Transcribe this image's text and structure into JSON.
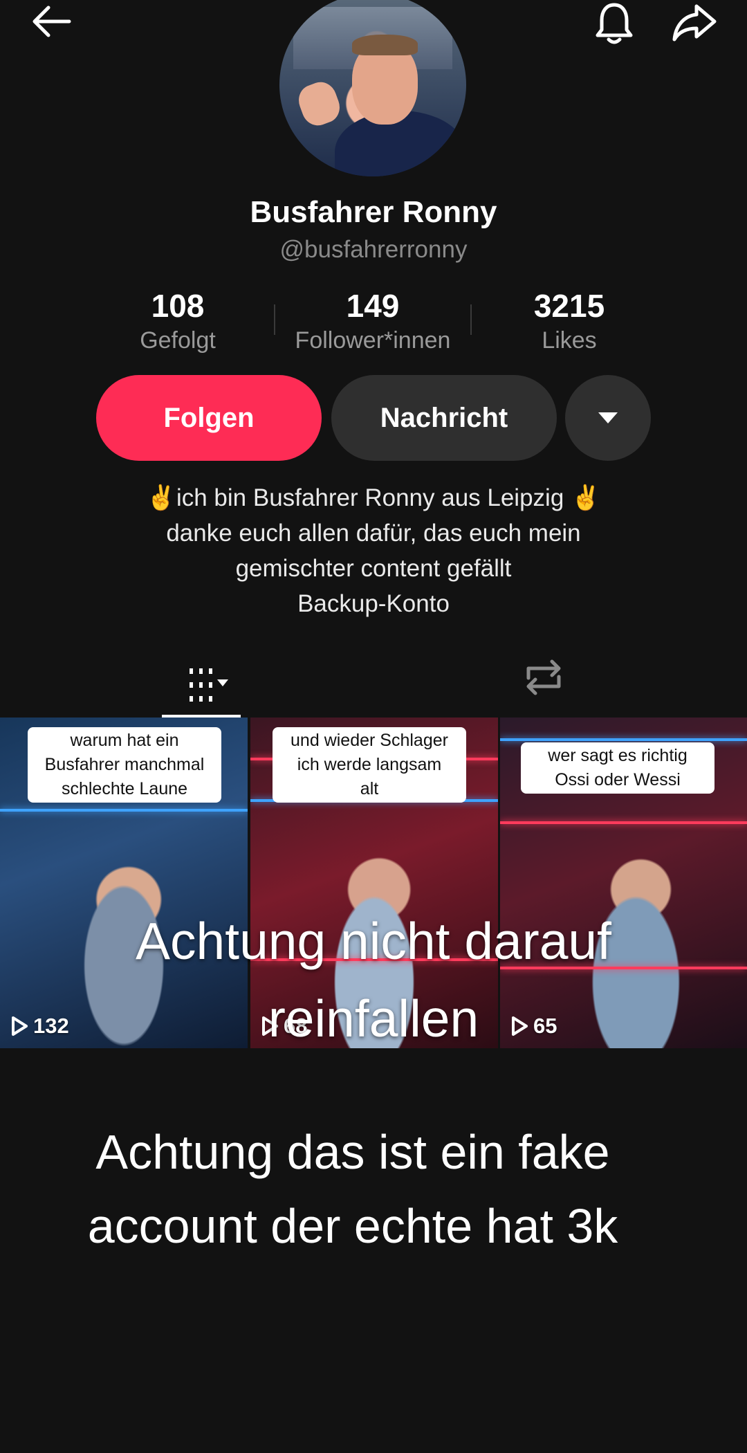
{
  "header": {
    "back_icon": "arrow-left-icon",
    "bell_icon": "bell-icon",
    "share_icon": "share-arrow-icon"
  },
  "profile": {
    "name": "Busfahrer Ronny",
    "handle": "@busfahrerronny",
    "avatar": "profile-photo"
  },
  "stats": {
    "following": {
      "value": "108",
      "label": "Gefolgt"
    },
    "followers": {
      "value": "149",
      "label": "Follower*innen"
    },
    "likes": {
      "value": "3215",
      "label": "Likes"
    }
  },
  "actions": {
    "follow_label": "Folgen",
    "message_label": "Nachricht",
    "more_icon": "caret-down-icon"
  },
  "bio": {
    "line1": "✌️ich bin Busfahrer Ronny aus Leipzig ✌️",
    "line2": "danke euch allen dafür, das euch mein",
    "line3": "gemischter content gefällt",
    "line4": "Backup-Konto"
  },
  "tabs": {
    "videos_icon": "grid-columns-icon",
    "reposts_icon": "repost-icon"
  },
  "videos": [
    {
      "caption_lines": [
        "warum hat ein",
        "Busfahrer manchmal",
        "schlechte Laune"
      ],
      "plays": "132"
    },
    {
      "caption_lines": [
        "und wieder Schlager",
        "ich werde langsam",
        "alt"
      ],
      "plays": "68"
    },
    {
      "caption_lines": [
        "wer sagt es richtig",
        "Ossi oder Wessi"
      ],
      "plays": "65"
    }
  ],
  "overlay": {
    "text1_line1": "Achtung nicht darauf",
    "text1_line2": "reinfallen",
    "text2_line1": "Achtung das ist ein fake",
    "text2_line2": "account der echte hat 3k"
  },
  "colors": {
    "background": "#121212",
    "follow": "#fe2c55",
    "secondary_button": "#2f2f2f",
    "muted_text": "#8a8a8a"
  }
}
